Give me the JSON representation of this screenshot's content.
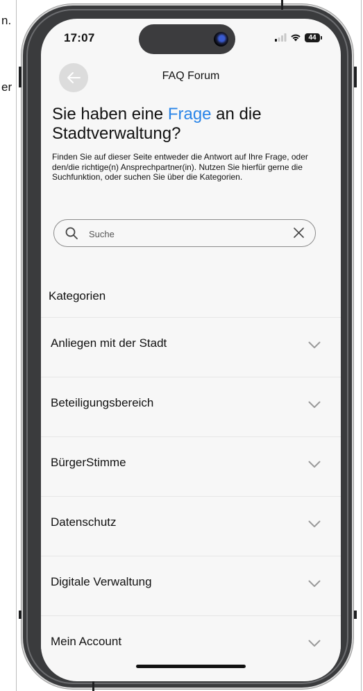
{
  "background_text": {
    "fragment_1": "n.",
    "fragment_2": "er"
  },
  "status_bar": {
    "time": "17:07",
    "battery": "44"
  },
  "header": {
    "title": "FAQ Forum"
  },
  "headline": {
    "part1": "Sie haben eine ",
    "accent": "Frage",
    "part2": " an die Stadtverwaltung?"
  },
  "intro_text": "Finden Sie auf dieser Seite entweder die Antwort auf Ihre Frage, oder den/die richtige(n) Ansprechpartner(in). Nutzen Sie hierfür gerne die Suchfunktion, oder suchen Sie über die Kategorien.",
  "search": {
    "placeholder": "Suche",
    "value": ""
  },
  "categories": {
    "title": "Kategorien",
    "items": [
      {
        "label": "Anliegen mit der Stadt"
      },
      {
        "label": "Beteiligungsbereich"
      },
      {
        "label": "BürgerStimme"
      },
      {
        "label": "Datenschutz"
      },
      {
        "label": "Digitale Verwaltung"
      },
      {
        "label": "Mein Account"
      }
    ]
  },
  "colors": {
    "accent": "#2a85e8",
    "screen_bg": "#f7f7f7",
    "frame": "#3a3b3d"
  }
}
